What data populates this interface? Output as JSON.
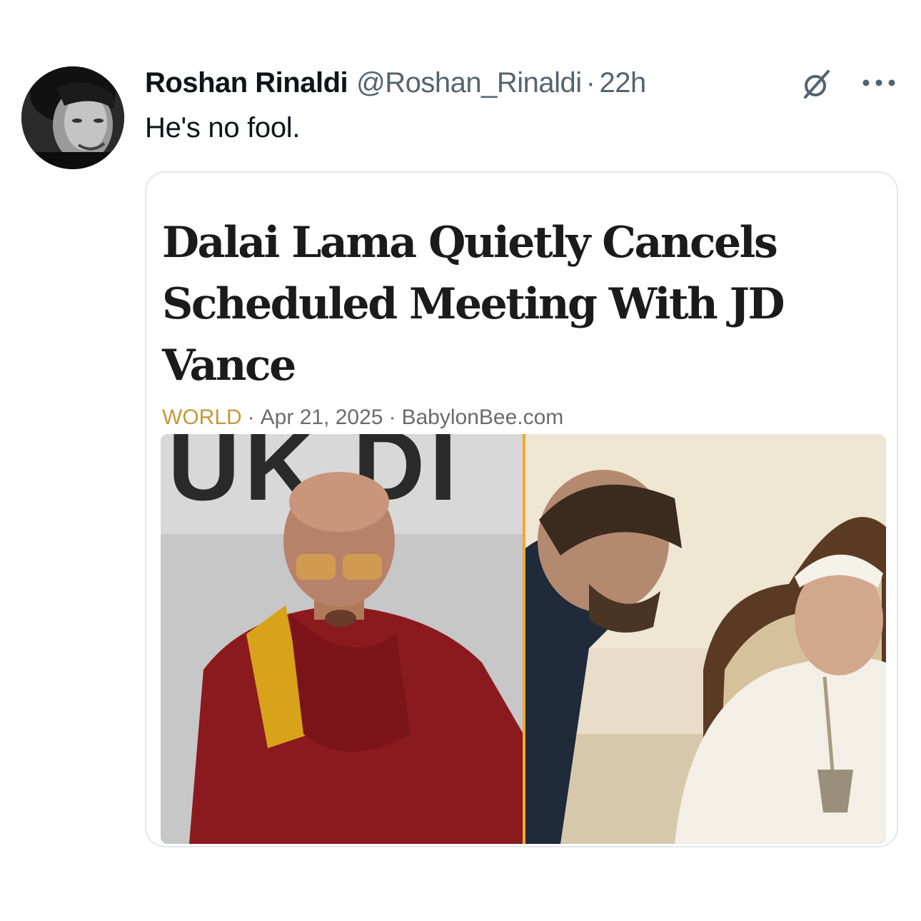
{
  "tweet": {
    "author_name": "Roshan Rinaldi",
    "author_handle": "@Roshan_Rinaldi",
    "separator": "·",
    "time": "22h",
    "text": "He's no fool.",
    "icons": {
      "avatar": "profile-photo",
      "grok": "grok-icon",
      "more": "more-icon"
    }
  },
  "card": {
    "headline": "Dalai Lama Quietly Cancels Scheduled Meeting With JD Vance",
    "category": "WORLD",
    "dot1": "·",
    "date": "Apr 21, 2025",
    "dot2": "·",
    "source": "BabylonBee.com",
    "image_sign_text": "UK DI",
    "colors": {
      "category": "#c49a3a",
      "divider": "#f0a830",
      "robe": "#8b1a1f",
      "sash": "#d9a21b"
    }
  }
}
